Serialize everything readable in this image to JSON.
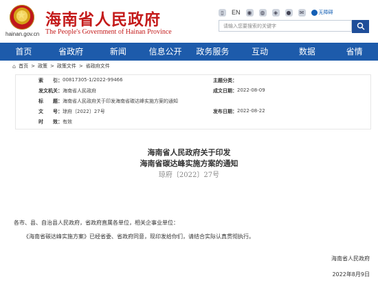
{
  "header": {
    "site_name": "海南省人民政府",
    "site_name_en": "The People's Government of Hainan Province",
    "domain": "hainan.gov.cn",
    "lang_en": "EN",
    "accessibility": "无障碍",
    "search_placeholder": "请输入您要搜索的关键字"
  },
  "nav": [
    "首页",
    "省政府",
    "新闻",
    "信息公开",
    "政务服务",
    "互动",
    "数据",
    "省情"
  ],
  "breadcrumb": [
    "首页",
    "政策",
    "政策文件",
    "省政府文件"
  ],
  "meta": {
    "index_label": "索　　引：",
    "index_value": "00817305-1/2022-99466",
    "topic_label": "主题分类：",
    "topic_value": "",
    "publisher_label": "发文机关：",
    "publisher_value": "海南省人民政府",
    "date_made_label": "成文日期：",
    "date_made_value": "2022-08-09",
    "title_label": "标　　题：",
    "title_value": "海南省人民政府关于印发海南省碳达峰实施方案的通知",
    "docno_label": "文　　号：",
    "docno_value": "琼府〔2022〕27号",
    "pubdate_label": "发布日期：",
    "pubdate_value": "2022-08-22",
    "validity_label": "时　　效：",
    "validity_value": "有效"
  },
  "document": {
    "title_line1": "海南省人民政府关于印发",
    "title_line2": "海南省碳达峰实施方案的通知",
    "number": "琼府〔2022〕27号",
    "addressee": "各市、县、自治县人民政府，省政府直属各单位，相关企事业单位：",
    "body": "《海南省碳达峰实施方案》已经省委、省政府同意，现印发给你们，请结合实际认真贯彻执行。",
    "signature": "海南省人民政府",
    "date": "2022年8月9日"
  }
}
